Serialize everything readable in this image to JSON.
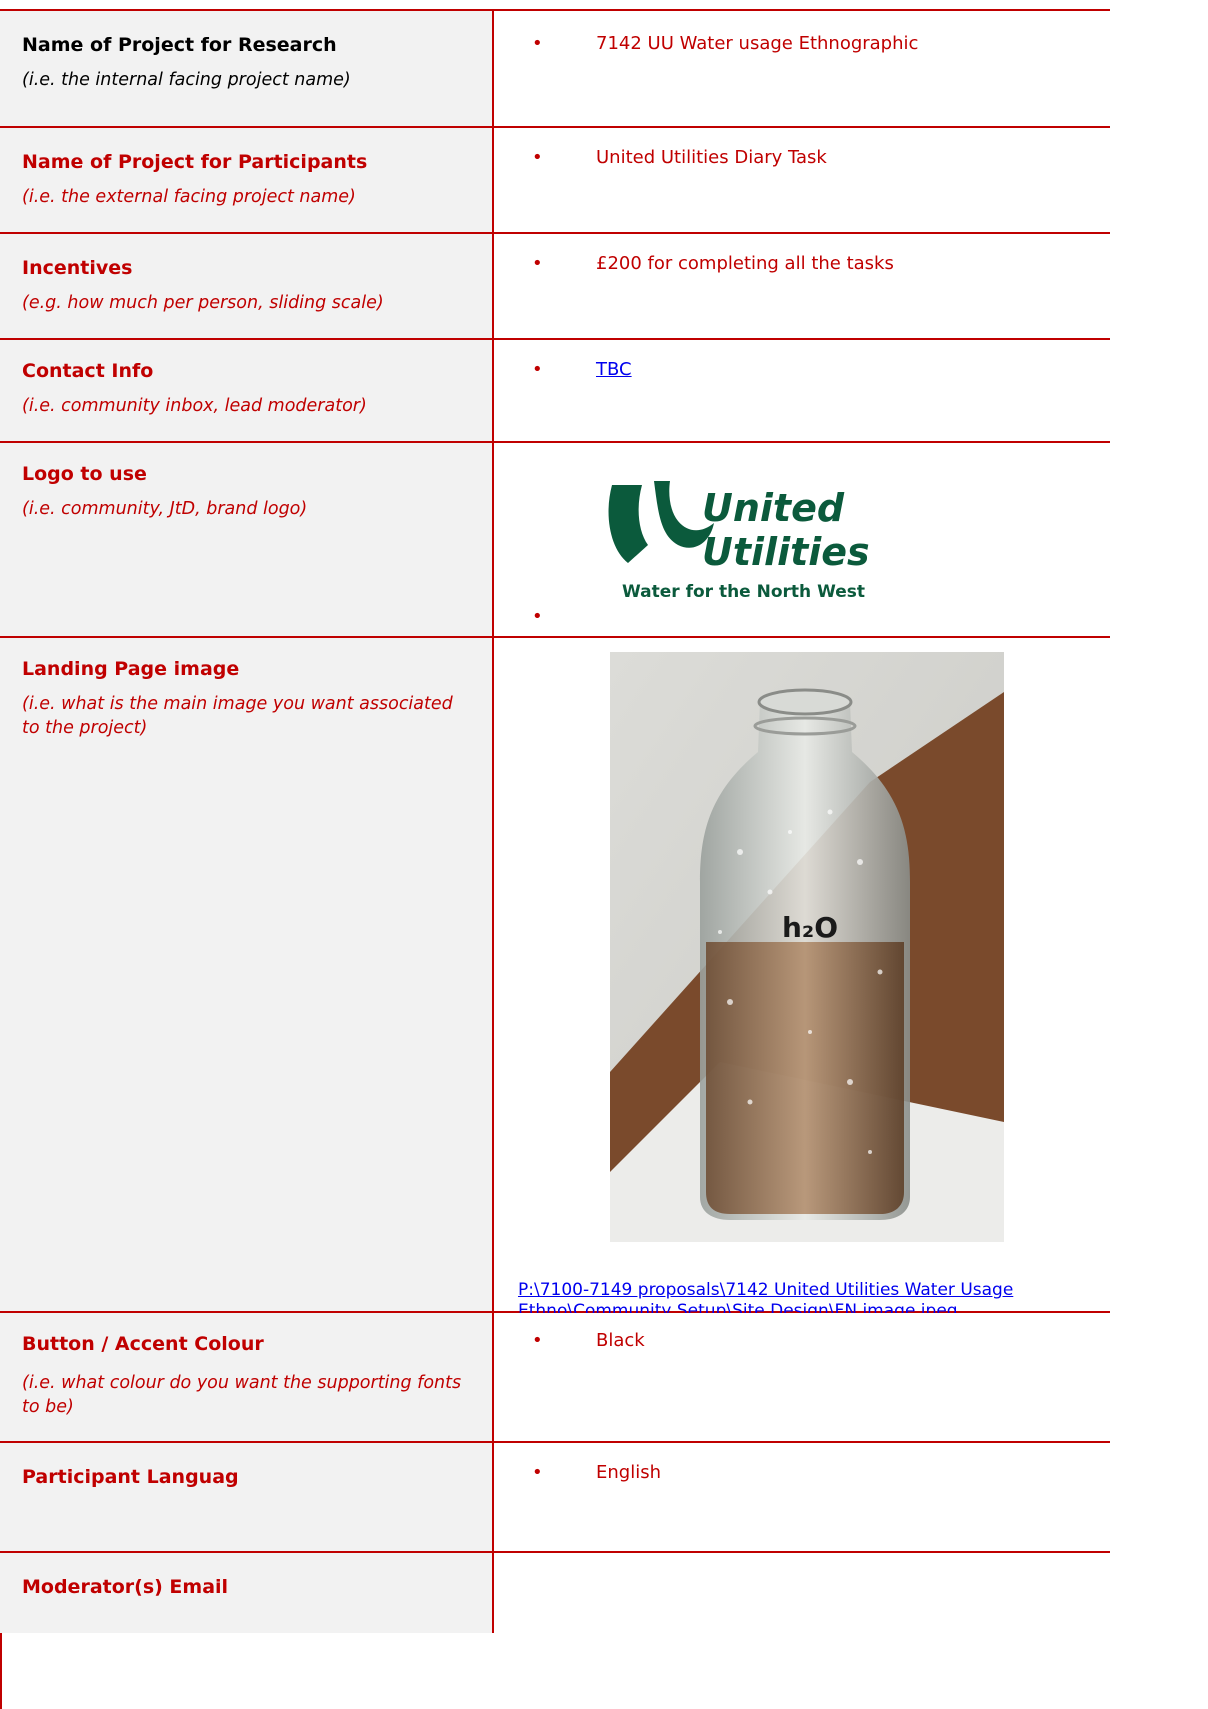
{
  "rows": [
    {
      "label": "Name of Project for Research",
      "hint": "(i.e. the internal facing project name)",
      "value": "7142 UU Water usage Ethnographic"
    },
    {
      "label": "Name of Project for Participants",
      "hint": "(i.e. the external facing project name)",
      "value": "United Utilities Diary Task"
    },
    {
      "label": "Incentives",
      "hint": "(e.g. how much per person, sliding scale)",
      "value": "£200 for completing all the tasks"
    },
    {
      "label": "Contact Info",
      "hint": "(i.e. community inbox, lead moderator)",
      "value": "TBC"
    },
    {
      "label": "Logo to use",
      "hint": "(i.e. community, JtD, brand logo)",
      "logo": {
        "line1": "United",
        "line2": "Utilities",
        "tagline": "Water for the North West"
      }
    },
    {
      "label": "Landing Page image",
      "hint": "(i.e. what is the main image you want associated to the project)",
      "image_caption": "h₂O",
      "path": "P:\\7100-7149 proposals\\7142 United Utilities Water Usage Ethno\\Community Setup\\Site Design\\FN image.jpeg"
    },
    {
      "label": "Button / Accent Colour",
      "hint": "(i.e. what colour do you want the supporting fonts to be)",
      "value": "Black"
    },
    {
      "label": "Participant Languag",
      "value": "English"
    },
    {
      "label": "Moderator(s) Email"
    }
  ],
  "bullet": "•",
  "colors": {
    "accent": "#c00000",
    "link": "#0000ee",
    "logo_green": "#0b5a3c"
  }
}
